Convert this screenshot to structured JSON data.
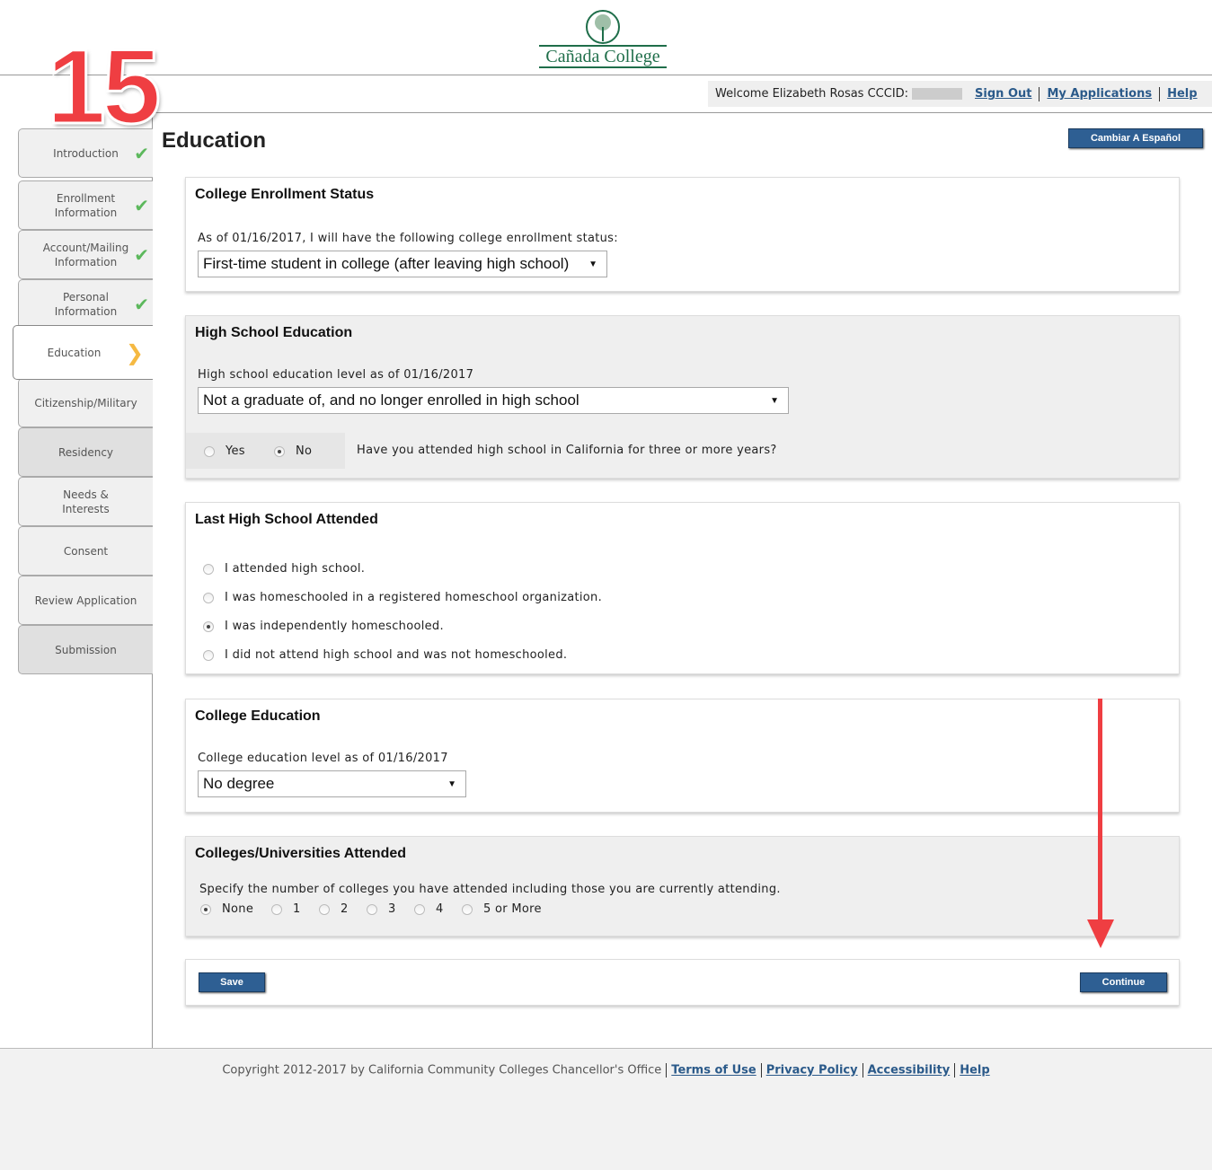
{
  "logo": {
    "name": "Cañada College"
  },
  "annotation": {
    "step_number": "15"
  },
  "userbar": {
    "welcome": "Welcome Elizabeth Rosas CCCID:",
    "sign_out": "Sign Out",
    "my_applications": "My Applications",
    "help": "Help"
  },
  "page": {
    "title": "Education",
    "language_button": "Cambiar A Español"
  },
  "sidebar": {
    "items": [
      {
        "label": "Introduction",
        "status": "complete"
      },
      {
        "label": "Enrollment Information",
        "status": "complete"
      },
      {
        "label": "Account/Mailing Information",
        "status": "complete"
      },
      {
        "label": "Personal Information",
        "status": "complete"
      },
      {
        "label": "Education",
        "status": "current"
      },
      {
        "label": "Citizenship/Military",
        "status": "pending"
      },
      {
        "label": "Residency",
        "status": "locked"
      },
      {
        "label": "Needs & Interests",
        "status": "pending"
      },
      {
        "label": "Consent",
        "status": "pending"
      },
      {
        "label": "Review Application",
        "status": "pending"
      },
      {
        "label": "Submission",
        "status": "locked"
      }
    ]
  },
  "enrollment": {
    "heading": "College Enrollment Status",
    "label": "As of 01/16/2017, I will have the following college enrollment status:",
    "value": "First-time student in college (after leaving high school)"
  },
  "high_school": {
    "heading": "High School Education",
    "label": "High school education level as of 01/16/2017",
    "value": "Not a graduate of, and no longer enrolled in high school",
    "yes": "Yes",
    "no": "No",
    "selected": "No",
    "question": "Have you attended high school in California for three or more years?"
  },
  "last_hs": {
    "heading": "Last High School Attended",
    "options": [
      "I attended high school.",
      "I was homeschooled in a registered homeschool organization.",
      "I was independently homeschooled.",
      "I did not attend high school and was not homeschooled."
    ],
    "selected": "I was independently homeschooled."
  },
  "college_ed": {
    "heading": "College Education",
    "label": "College education level as of 01/16/2017",
    "value": "No degree"
  },
  "colleges": {
    "heading": "Colleges/Universities Attended",
    "label": "Specify the number of colleges you have attended including those you are currently attending.",
    "options": [
      "None",
      "1",
      "2",
      "3",
      "4",
      "5 or More"
    ],
    "selected": "None"
  },
  "actions": {
    "save": "Save",
    "continue": "Continue"
  },
  "footer": {
    "copyright": "Copyright 2012-2017 by California Community Colleges Chancellor's Office",
    "terms": "Terms of Use",
    "privacy": "Privacy Policy",
    "accessibility": "Accessibility",
    "help": "Help"
  }
}
